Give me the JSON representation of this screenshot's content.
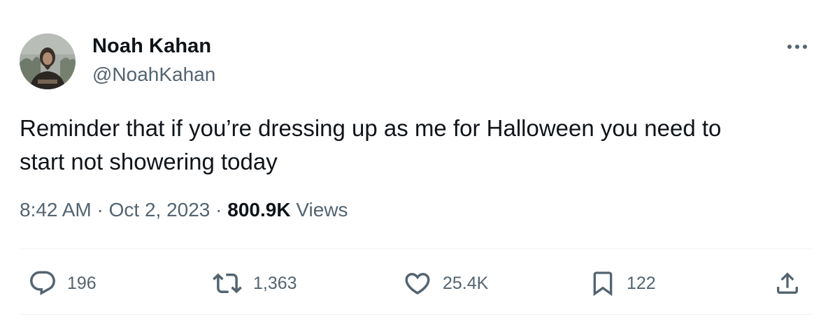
{
  "author": {
    "name": "Noah Kahan",
    "handle": "@NoahKahan"
  },
  "tweet": {
    "text_line1": "Reminder that if you’re dressing up as me for Halloween you need to",
    "text_line2": "start not showering today"
  },
  "meta": {
    "time": "8:42 AM",
    "separator": "·",
    "date": "Oct 2, 2023",
    "views_count": "800.9K",
    "views_label": "Views"
  },
  "actions": {
    "replies": "196",
    "reposts": "1,363",
    "likes": "25.4K",
    "bookmarks": "122"
  },
  "icons": {
    "reply": "reply-icon",
    "repost": "repost-icon",
    "like": "heart-icon",
    "bookmark": "bookmark-icon",
    "share": "share-icon",
    "more": "more-icon"
  },
  "colors": {
    "text_primary": "#0f1419",
    "text_secondary": "#536471",
    "divider": "#eff3f4"
  }
}
